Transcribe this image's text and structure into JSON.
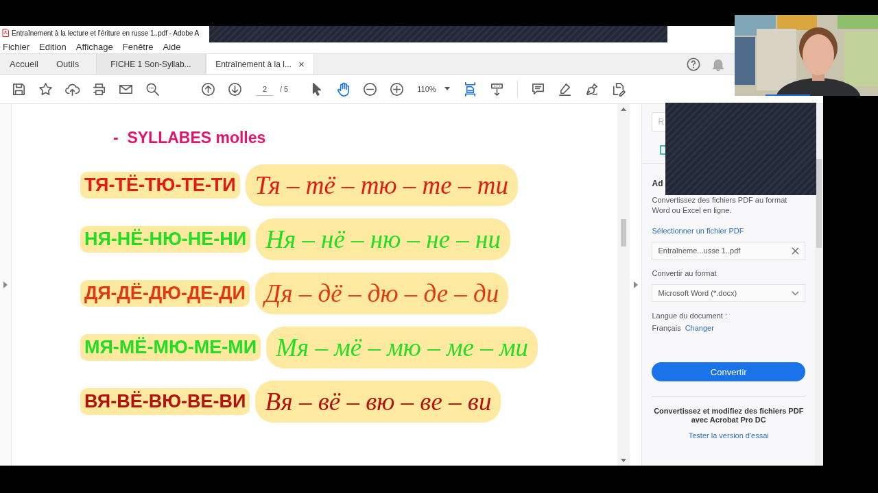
{
  "window": {
    "title": "Entraînement à la lecture et l'ériture en russe 1..pdf - Adobe A"
  },
  "menu": [
    "Fichier",
    "Edition",
    "Affichage",
    "Fenêtre",
    "Aide"
  ],
  "nav": [
    "Accueil",
    "Outils"
  ],
  "doc_tabs": [
    {
      "label": "FICHE 1 Son-Syllab...",
      "selected": false
    },
    {
      "label": "Entraînement à la l...",
      "selected": true,
      "close": "×"
    }
  ],
  "top_icons": [
    {
      "kind": "help"
    },
    {
      "kind": "bell"
    }
  ],
  "toolbar": {
    "file_tools": [
      {
        "kind": "save"
      },
      {
        "kind": "star"
      },
      {
        "kind": "upload"
      },
      {
        "kind": "print"
      },
      {
        "kind": "mail"
      },
      {
        "kind": "zoom-search"
      }
    ],
    "nav_tools": [
      {
        "kind": "up"
      },
      {
        "kind": "down"
      }
    ],
    "page": {
      "value": "2",
      "total": "/ 5"
    },
    "mode_tools": [
      {
        "kind": "pointer",
        "selected": false
      },
      {
        "kind": "hand",
        "selected": true
      }
    ],
    "zoom_tools": [
      {
        "kind": "minus"
      },
      {
        "kind": "plus"
      }
    ],
    "zoom": {
      "value": "110%"
    },
    "view_tools": [
      {
        "kind": "fit"
      },
      {
        "kind": "scroll"
      }
    ],
    "edit_tools": [
      {
        "kind": "comment"
      },
      {
        "kind": "highlight"
      },
      {
        "kind": "sign"
      },
      {
        "kind": "edit"
      }
    ]
  },
  "document": {
    "heading": "-  SYLLABES molles",
    "rows": [
      {
        "print": "ТЯ-ТЁ-ТЮ-ТЕ-ТИ",
        "cursive": "Тя – тё – тю – те – ти",
        "color": "#e31a12"
      },
      {
        "print": "НЯ-НЁ-НЮ-НЕ-НИ",
        "cursive": "Ня – нё – ню – не – ни",
        "color": "#22dd22"
      },
      {
        "print": "ДЯ-ДЁ-ДЮ-ДЕ-ДИ",
        "cursive": "Дя – дё – дю – де – ди",
        "color": "#e3380f"
      },
      {
        "print": "МЯ-МЁ-МЮ-МЕ-МИ",
        "cursive": "Мя – мё – мю – ме – ми",
        "color": "#22dd22"
      },
      {
        "print": "ВЯ-ВЁ-ВЮ-ВЕ-ВИ",
        "cursive": "Вя – вё – вю – ве – ви",
        "color": "#b5120e"
      }
    ]
  },
  "panel": {
    "search": {
      "placeholder": "R"
    },
    "heading": "Ad",
    "description": "Convertissez des fichiers PDF au format Word ou Excel en ligne.",
    "select_link": "Sélectionner un fichier PDF",
    "file_field": {
      "value": "Entraîneme...usse 1..pdf"
    },
    "format_label": "Convertir au format",
    "format_select": {
      "value": "Microsoft Word (*.docx)"
    },
    "language_label": "Langue du document :",
    "language": "Français",
    "change_link": "Changer",
    "convert_button": "Convertir",
    "promo": "Convertissez et modifiez des fichiers PDF avec Acrobat Pro DC",
    "trial_link": "Tester la version d'essai"
  },
  "video": {
    "kind": "picture"
  }
}
